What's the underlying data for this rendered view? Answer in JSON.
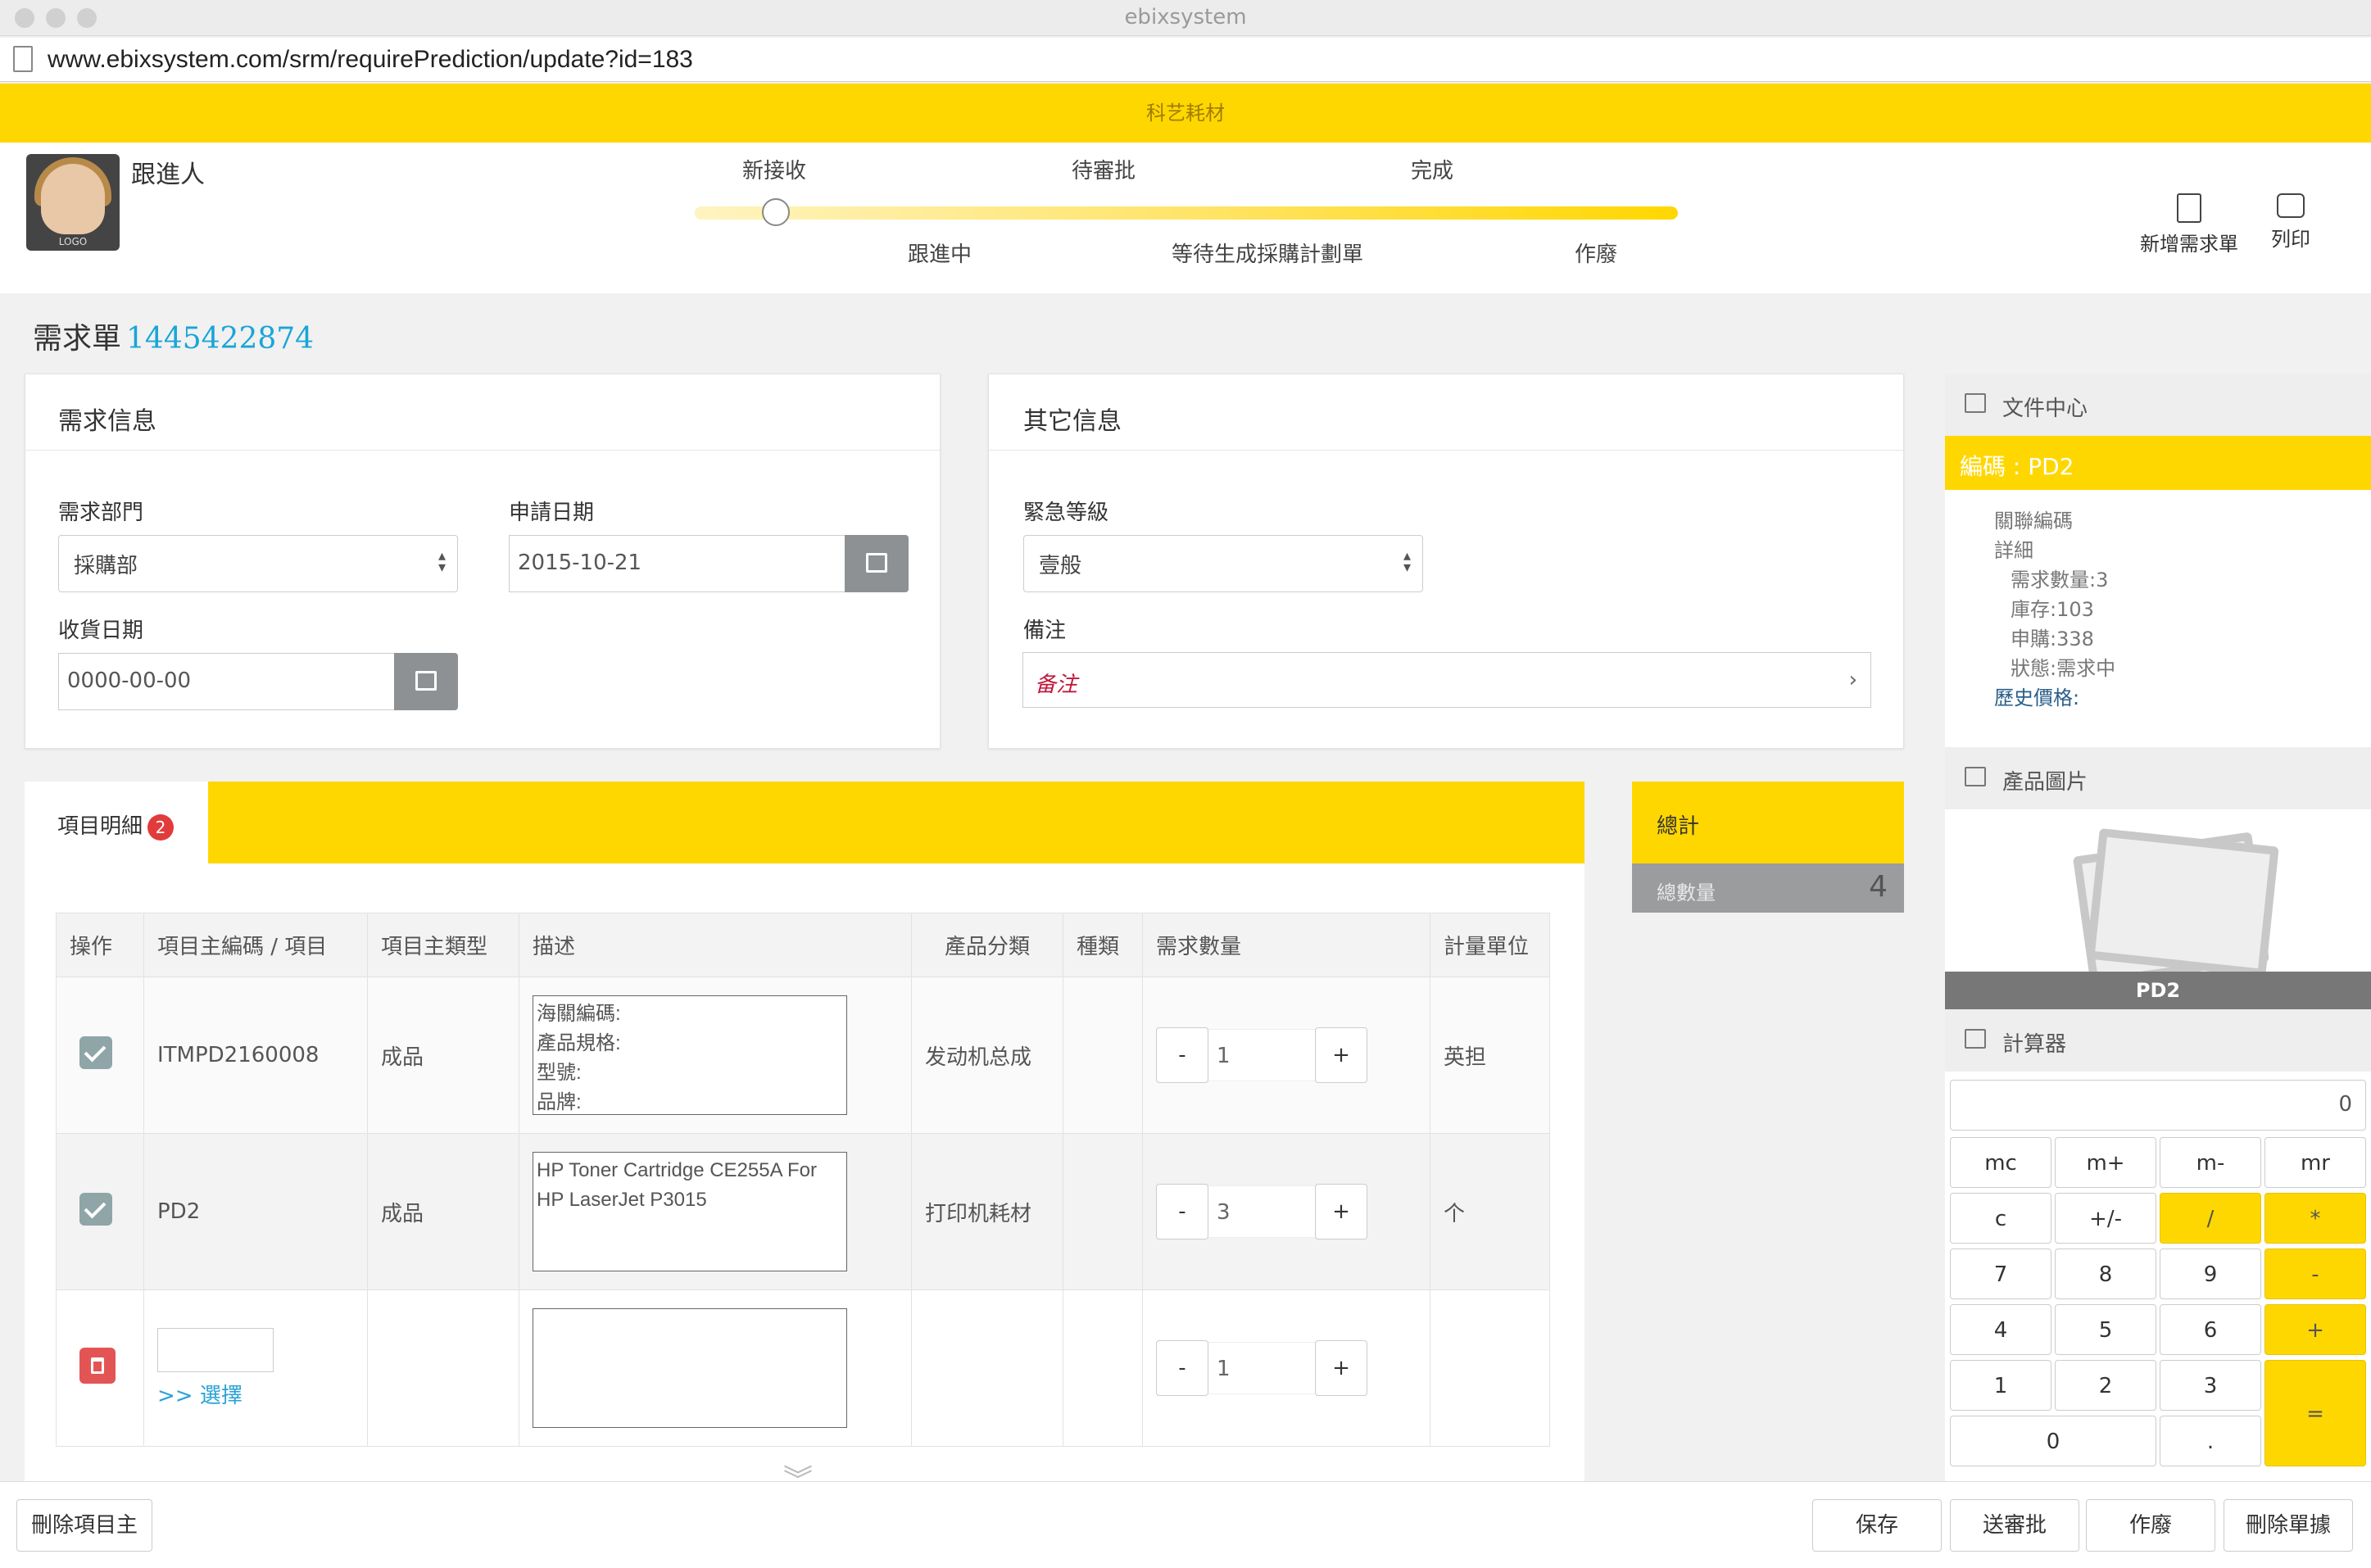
{
  "window": {
    "title": "ebixsystem"
  },
  "browser": {
    "url": "www.ebixsystem.com/srm/requirePrediction/update?id=183"
  },
  "brand": {
    "name": "科艺耗材"
  },
  "header": {
    "avatar_text": "LOGO",
    "assignee_label": "跟進人",
    "stages_top": [
      "新接收",
      "待審批",
      "完成"
    ],
    "stages_bottom": [
      "跟進中",
      "等待生成採購計劃單",
      "作廢"
    ],
    "progress": 1.0,
    "actions": {
      "new_label": "新增需求單",
      "print_label": "列印"
    }
  },
  "document": {
    "title": "需求單",
    "number": "1445422874"
  },
  "requirement_info": {
    "title": "需求信息",
    "department_label": "需求部門",
    "department_value": "採購部",
    "apply_date_label": "申請日期",
    "apply_date_value": "2015-10-21",
    "receive_date_label": "收貨日期",
    "receive_date_placeholder": "0000-00-00"
  },
  "other_info": {
    "title": "其它信息",
    "urgency_label": "緊急等級",
    "urgency_value": "壹般",
    "remark_label": "備注",
    "remark_value": "备注"
  },
  "items": {
    "tab_label": "項目明細",
    "badge": "2",
    "columns": [
      "操作",
      "項目主編碼 / 項目",
      "項目主類型",
      "描述",
      "產品分類",
      "種類",
      "需求數量",
      "計量單位"
    ],
    "rows": [
      {
        "code": "ITMPD2160008",
        "type": "成品",
        "description": "海關編碼:\n產品規格:\n型號:\n品牌:",
        "category": "发动机总成",
        "kind": "",
        "qty": "1",
        "unit": "英担"
      },
      {
        "code": "PD2",
        "type": "成品",
        "description": "HP  Toner Cartridge CE255A For HP LaserJet P3015",
        "category": "打印机耗材",
        "kind": "",
        "qty": "3",
        "unit": "个"
      }
    ],
    "new_row": {
      "select_link": ">> 選擇",
      "qty": "1"
    },
    "minus": "-",
    "plus": "+"
  },
  "totals": {
    "title": "總計",
    "qty_label": "總數量",
    "qty_value": "4"
  },
  "sidebar": {
    "file_center": "文件中心",
    "code_label": "編碼 : PD2",
    "tree": {
      "linked": "關聯編碼",
      "detail": "詳細",
      "demand_qty": "需求數量:3",
      "stock": "庫存:103",
      "purchase": "申購:338",
      "status": "狀態:需求中",
      "history": "歷史價格:"
    },
    "product_image": "產品圖片",
    "image_caption": "PD2",
    "calculator": "計算器"
  },
  "calculator": {
    "display": "0",
    "keys": [
      "mc",
      "m+",
      "m-",
      "mr",
      "c",
      "+/-",
      "/",
      "*",
      "7",
      "8",
      "9",
      "-",
      "4",
      "5",
      "6",
      "+",
      "1",
      "2",
      "3",
      "=",
      "0",
      "."
    ]
  },
  "footer": {
    "delete_item": "刪除項目主",
    "save": "保存",
    "submit": "送審批",
    "void": "作廢",
    "delete_doc": "刪除單據"
  },
  "colors": {
    "accent": "#ffd700",
    "link": "#19a5d8",
    "danger": "#e35555"
  }
}
